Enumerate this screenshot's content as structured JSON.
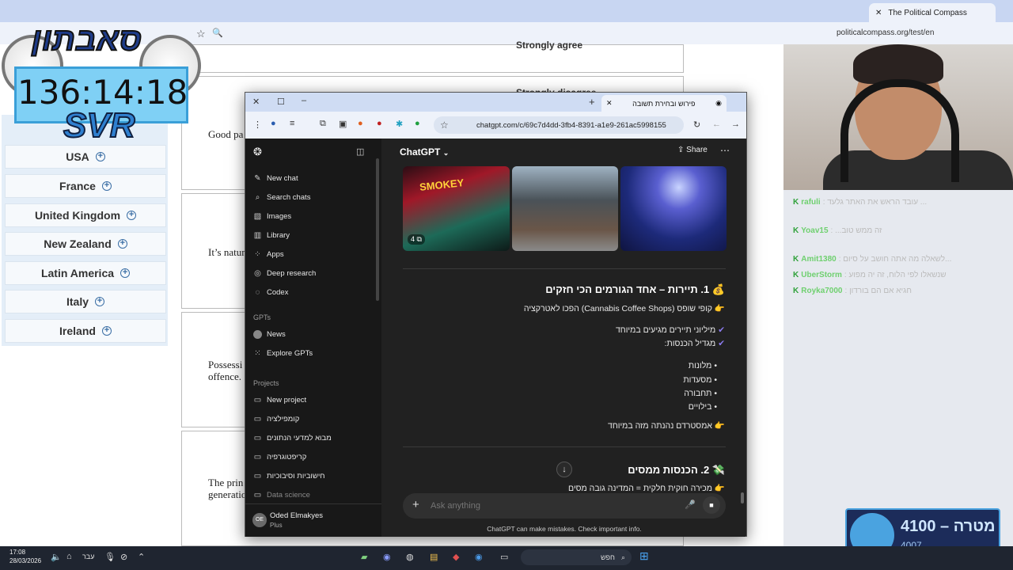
{
  "bg_browser": {
    "tab_title": "The Political Compass",
    "url": "politicalcompass.org/test/en",
    "options": [
      "Strongly agree",
      "Strongly disagree"
    ],
    "countries": [
      "USA",
      "France",
      "United Kingdom",
      "New Zealand",
      "Latin America",
      "Italy",
      "Ireland"
    ],
    "questions": [
      "Good pa",
      "It’s natur",
      "Possessi",
      "offence.",
      "The  prin",
      "generatio"
    ]
  },
  "overlay": {
    "logo_title": "סאבתון",
    "timer": "136:14:18",
    "badge": "SVR"
  },
  "chat": {
    "lines": [
      {
        "user": "rafuli",
        "text": ": עובד הראש את האתר גלעד ..."
      },
      {
        "user": "Yoav15",
        "text": ": ...זה ממש טוב"
      },
      {
        "user": "Amit1380",
        "text": ": לשאלה מה אתה חושב על סיום..."
      },
      {
        "user": "UberStorm",
        "text": ": שנשאלו לפי הלוח, זה יה מפוע"
      },
      {
        "user": "Royka7000",
        "text": ": חגיא אם הם בורדון"
      }
    ]
  },
  "goal": {
    "label": "מטרה",
    "value": "4100",
    "current": "4007"
  },
  "gpt_browser": {
    "tab_title": "פירוש ובחירת תשובה",
    "url": "chatgpt.com/c/69c7d4dd-3fb4-8391-a1e9-261ac5998155"
  },
  "sidebar": {
    "items": [
      "New chat",
      "Search chats",
      "Images",
      "Library",
      "Apps",
      "Deep research",
      "Codex"
    ],
    "gpts_header": "GPTs",
    "gpts": [
      "News",
      "Explore GPTs"
    ],
    "projects_header": "Projects",
    "projects": [
      "New project",
      "קומפילציה",
      "מבוא למדעי הנתונים",
      "קריפטוגרפיה",
      "חישוביות וסיבוכיות",
      "Data science"
    ],
    "user_name": "Oded Elmakyes",
    "user_plan": "Plus",
    "user_initials": "OE"
  },
  "main": {
    "model": "ChatGPT",
    "share": "Share",
    "image_count": "4",
    "section1_title": "💰 1. תיירות – אחד הגורמים הכי חזקים",
    "section1_line": "👉 קופי שופס (Cannabis Coffee Shops) הפכו לאטרקציה",
    "check1": "מיליוני תיירים מגיעים במיוחד",
    "check2": "מגדיל הכנסות:",
    "bullets": [
      "מלונות",
      "מסעדות",
      "תחבורה",
      "בילויים"
    ],
    "section1_end": "👉 אמסטרדם נהנתה מזה במיוחד",
    "section2_title": "💸 2. הכנסות ממסים",
    "section2_line": "👉 מכירה חוקית חלקית = המדינה גובה מסים",
    "composer_placeholder": "Ask anything",
    "disclaimer": "ChatGPT can make mistakes. Check important info."
  },
  "taskbar": {
    "time": "17:08",
    "date": "28/03/2026",
    "lang": "עבר",
    "search": "חפש"
  },
  "colors": {
    "gpt_bg": "#212121",
    "sidebar_bg": "#181818",
    "chat_user": "#6fd06f"
  }
}
